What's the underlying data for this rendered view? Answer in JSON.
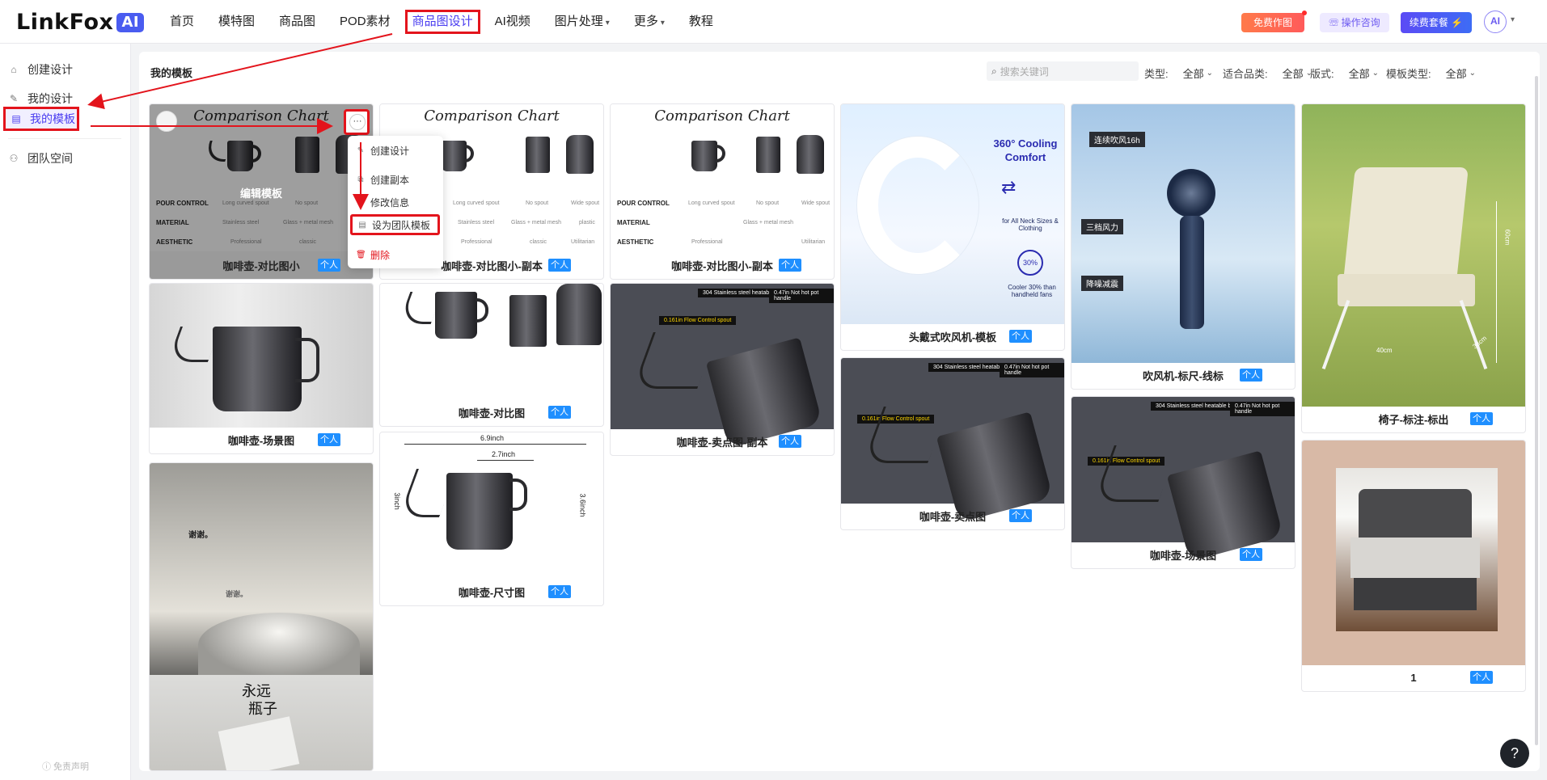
{
  "header": {
    "logo_text": "LinkFox",
    "logo_ai": "AI",
    "nav": [
      {
        "label": "首页"
      },
      {
        "label": "模特图"
      },
      {
        "label": "商品图"
      },
      {
        "label": "POD素材"
      },
      {
        "label": "商品图设计"
      },
      {
        "label": "AI视频"
      },
      {
        "label": "图片处理"
      },
      {
        "label": "更多"
      },
      {
        "label": "教程"
      }
    ],
    "free_btn": "免费作图",
    "consult_btn": "操作咨询",
    "renew_btn": "续费套餐 ⚡",
    "avatar": "AI"
  },
  "sidebar": {
    "items": [
      {
        "label": "创建设计",
        "icon": "home-icon"
      },
      {
        "label": "我的设计",
        "icon": "brush-icon"
      },
      {
        "label": "我的模板",
        "icon": "template-icon"
      },
      {
        "label": "团队空间",
        "icon": "team-icon"
      }
    ],
    "disclaimer": "ⓘ 免责声明"
  },
  "main": {
    "title": "我的模板",
    "search_placeholder": "搜索关键词",
    "filters": [
      {
        "label": "类型:",
        "value": "全部"
      },
      {
        "label": "适合品类:",
        "value": "全部"
      },
      {
        "label": "版式:",
        "value": "全部"
      },
      {
        "label": "模板类型:",
        "value": "全部"
      }
    ]
  },
  "cards": {
    "c1": {
      "caption": "咖啡壶-对比图小",
      "badge": "个人",
      "overlay": "编辑模板"
    },
    "c2": {
      "caption": "咖啡壶-对比图小-副本",
      "badge": "个人"
    },
    "c3": {
      "caption": "咖啡壶-对比图小-副本",
      "badge": "个人"
    },
    "c4": {
      "caption": "头戴式吹风机-模板",
      "badge": "个人"
    },
    "c5": {
      "caption": "吹风机-标尺-线标",
      "badge": "个人"
    },
    "c6": {
      "caption": "椅子-标注-标出",
      "badge": "个人"
    },
    "c7": {
      "caption": "咖啡壶-场景图",
      "badge": "个人"
    },
    "c8": {
      "caption": "咖啡壶-对比图",
      "badge": "个人"
    },
    "c9": {
      "caption": "咖啡壶-卖点图-副本",
      "badge": "个人"
    },
    "c10": {
      "caption": "咖啡壶-卖点图",
      "badge": "个人"
    },
    "c11": {
      "caption": "咖啡壶-场景图",
      "badge": "个人"
    },
    "c12": {
      "caption": "1",
      "badge": "个人"
    },
    "c13": {
      "caption": "咖啡壶-尺寸图",
      "badge": "个人"
    }
  },
  "thumb_text": {
    "comparison_title": "Comparison Chart",
    "rows": [
      "POUR  CONTROL",
      "MATERIAL",
      "AESTHETIC"
    ],
    "pour_vals": [
      "Long curved spout",
      "No spout",
      "Wide spout"
    ],
    "mat_vals": [
      "Stainless steel",
      "Glass + metal mesh",
      "plastic"
    ],
    "aes_vals": [
      "Professional",
      "classic",
      "Utilitarian"
    ],
    "cooling_title": "360° Cooling Comfort",
    "cooling_sizes": "for All Neck Sizes & Clothing",
    "cooling_pct": "30%",
    "cooling_note": "Cooler 30% than handheld fans",
    "fan_tags": [
      "连续吹风16h",
      "三档风力",
      "降噪减震"
    ],
    "sell_tags": [
      "304 Stainless steel heatable body",
      "0.47in Not hot pot handle",
      "0.161in Flow Control spout"
    ],
    "dim_w": "6.9inch",
    "dim_w2": "2.7inch",
    "dim_h": "3inch",
    "dim_h2": "3.6inch",
    "chair_h": "60cm",
    "chair_w": "40cm",
    "chair_d": "38cm",
    "grey_text_1": "谢谢。",
    "grey_text_2": "谢谢。",
    "grey_title_1": "永远",
    "grey_title_2": "瓶子"
  },
  "menu": {
    "items": [
      {
        "label": "创建设计",
        "icon": "pen-icon"
      },
      {
        "label": "创建副本",
        "icon": "copy-icon"
      },
      {
        "label": "修改信息",
        "icon": "edit-icon"
      },
      {
        "label": "设为团队模板",
        "icon": "template-icon"
      },
      {
        "label": "删除",
        "icon": "trash-icon"
      }
    ]
  },
  "help": "?",
  "colors": {
    "accent": "#4a3df0",
    "annotation": "#e3141c",
    "badge": "#1f8fff"
  }
}
